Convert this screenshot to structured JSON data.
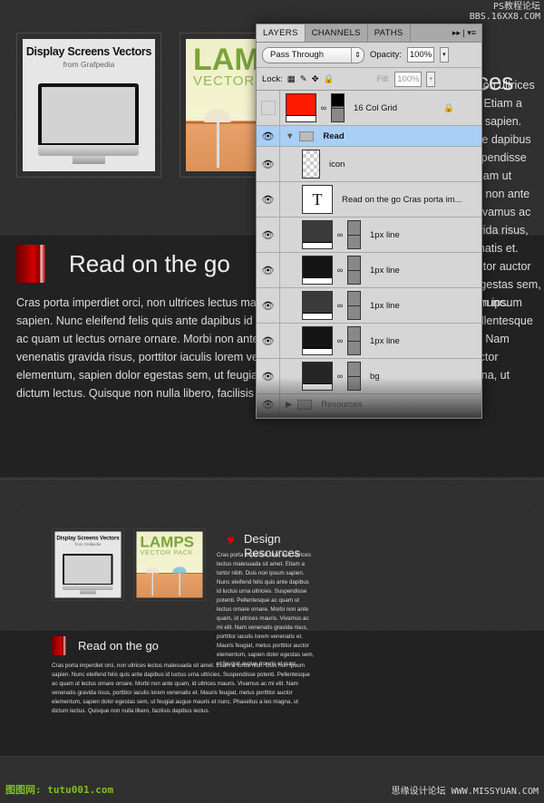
{
  "design": {
    "thumb1": {
      "title": "Display Screens Vectors",
      "subtitle": "from Grafpedia"
    },
    "thumb2": {
      "title": "LAMPS",
      "subtitle": "VECTOR PACK"
    },
    "heading": "Design Resources",
    "paragraph": "Cras porta imperdiet orci, non ultrices lectus malesuada sit amet. Etiam a tortor nibh. Duis non ipsum sapien. Nunc eleifend felis quis ante dapibus id luctus urna ultricies. Suspendisse potenti. Pellentesque ac quam ut lectus ornare ornare. Morbi non ante quam, id ultrices mauris. Vivamus ac mi elit. Nam venenatis gravida risus, porttitor iaculis lorem venenatis et. Mauris feugiat, metus porttitor auctor elementum, sapien dolor egestas sem, ut feugiat augue mauris et nunc."
  },
  "read": {
    "heading": "Read on the go",
    "paragraph": "Cras porta imperdiet orci, non ultrices lectus malesuada sit amet. Etiam a tortor nibh. Duis non ipsum sapien. Nunc eleifend felis quis ante dapibus id luctus urna ultricies. Suspendisse potenti. Pellentesque ac quam ut lectus ornare ornare. Morbi non ante quam, id ultrices mauris. Vivamus ac mi elit. Nam venenatis gravida risus, porttitor iaculis lorem venenatis et. Mauris feugiat, metus porttitor auctor elementum, sapien dolor egestas sem, ut feugiat augue mauris et nunc. Phasellus a leo magna, ut dictum lectus. Quisque non nulla libero, facilisis dapibus lectus."
  },
  "panel": {
    "tabs": [
      "LAYERS",
      "CHANNELS",
      "PATHS"
    ],
    "blend_mode": "Pass Through",
    "opacity_label": "Opacity:",
    "opacity": "100%",
    "lock_label": "Lock:",
    "fill_label": "Fill:",
    "fill": "100%",
    "layers": [
      {
        "name": "16 Col Grid",
        "visible": false,
        "locked": true,
        "color": "#ff1a00"
      },
      {
        "name": "Read",
        "group": true,
        "expanded": true,
        "selected": true
      },
      {
        "name": "icon"
      },
      {
        "name": "Read on the go  Cras porta im..."
      },
      {
        "name": "1px line",
        "color": "#3a3a3a"
      },
      {
        "name": "1px line",
        "color": "#141414"
      },
      {
        "name": "1px line",
        "color": "#3a3a3a"
      },
      {
        "name": "1px line",
        "color": "#141414"
      },
      {
        "name": "bg",
        "color": "#262626"
      },
      {
        "name": "Resources",
        "group": true
      }
    ]
  },
  "watermarks": {
    "top_right": "PS教程论坛\nBBS.16XX8.COM",
    "bottom_left": "图图网: tutu001.com",
    "bottom_right": "思缘设计论坛 WWW.MISSYUAN.COM"
  }
}
